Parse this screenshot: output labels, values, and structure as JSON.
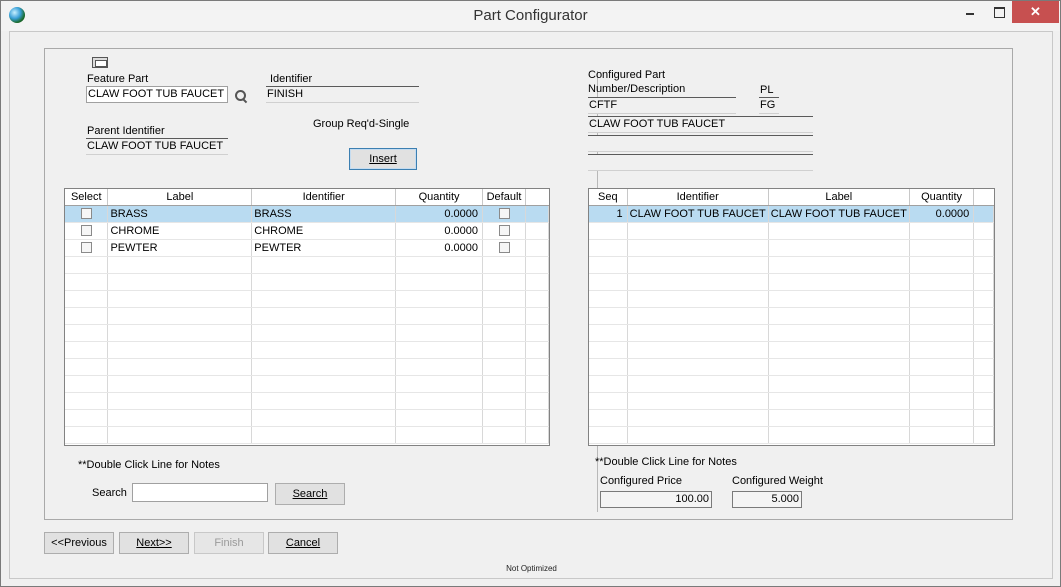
{
  "window": {
    "title": "Part Configurator",
    "close_glyph": "✕"
  },
  "left": {
    "feature_part_label": "Feature Part",
    "feature_part_value": "CLAW FOOT TUB FAUCET",
    "identifier_label": "Identifier",
    "identifier_value": "FINISH",
    "parent_identifier_label": "Parent Identifier",
    "parent_identifier_value": "CLAW FOOT TUB FAUCET",
    "group_text": "Group Req'd-Single",
    "insert_label": "Insert",
    "grid": {
      "columns": [
        "Select",
        "Label",
        "Identifier",
        "Quantity",
        "Default"
      ],
      "rows": [
        {
          "label": "BRASS",
          "identifier": "BRASS",
          "quantity": "0.0000"
        },
        {
          "label": "CHROME",
          "identifier": "CHROME",
          "quantity": "0.0000"
        },
        {
          "label": "PEWTER",
          "identifier": "PEWTER",
          "quantity": "0.0000"
        }
      ]
    },
    "notes_text": "**Double Click Line for Notes",
    "search_label": "Search",
    "search_value": "",
    "search_button": "Search"
  },
  "right": {
    "configured_part_label": "Configured Part",
    "number_desc_label": "Number/Description",
    "number_value": "CFTF",
    "pl_label": "PL",
    "pl_value": "FG",
    "desc_line1": "CLAW FOOT TUB FAUCET",
    "desc_line2": "",
    "desc_line3": "",
    "grid": {
      "columns": [
        "Seq",
        "Identifier",
        "Label",
        "Quantity"
      ],
      "rows": [
        {
          "seq": "1",
          "identifier": "CLAW FOOT TUB FAUCET",
          "label": "CLAW FOOT TUB FAUCET",
          "quantity": "0.0000"
        }
      ]
    },
    "notes_text": "**Double Click Line for Notes",
    "price_label": "Configured Price",
    "price_value": "100.00",
    "weight_label": "Configured Weight",
    "weight_value": "5.000"
  },
  "footer": {
    "previous": "<<Previous",
    "next": "Next>>",
    "finish": "Finish",
    "cancel": "Cancel",
    "status": "Not Optimized"
  }
}
